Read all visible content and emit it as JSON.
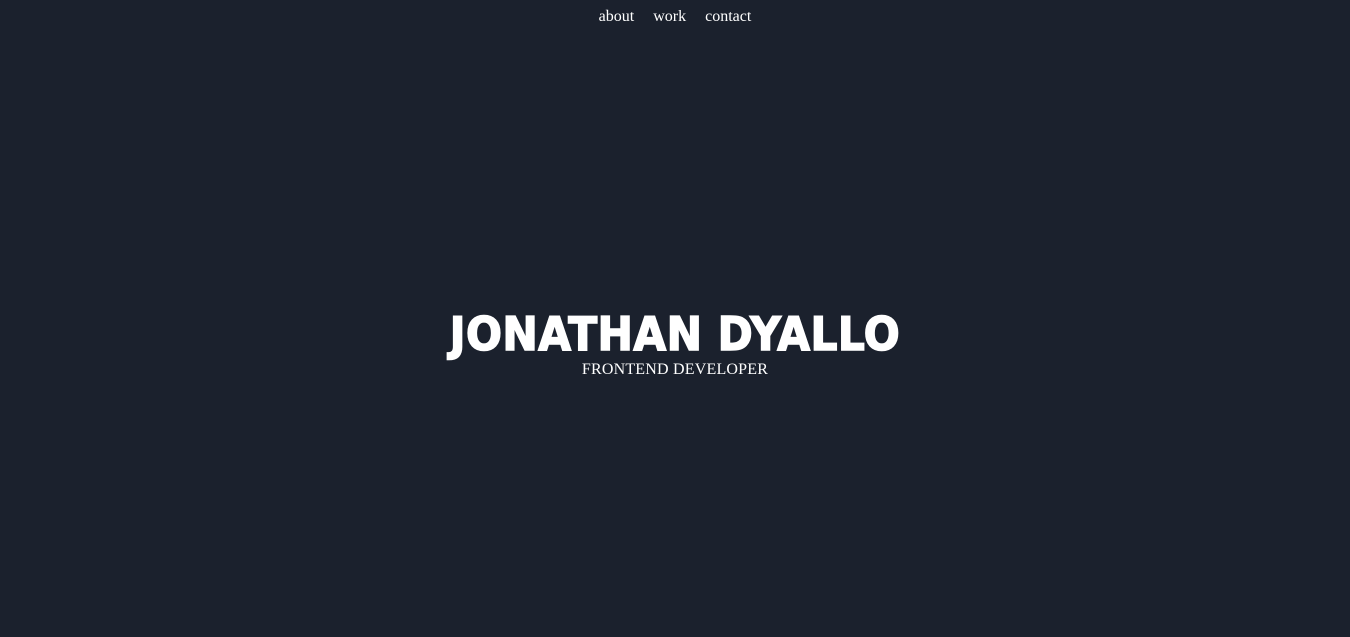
{
  "colors": {
    "background": "#1b212d",
    "text": "#ffffff"
  },
  "nav": {
    "items": [
      {
        "label": "about"
      },
      {
        "label": "work"
      },
      {
        "label": "contact"
      }
    ]
  },
  "hero": {
    "name": "JONATHAN DYALLO",
    "title": "FRONTEND DEVELOPER"
  }
}
